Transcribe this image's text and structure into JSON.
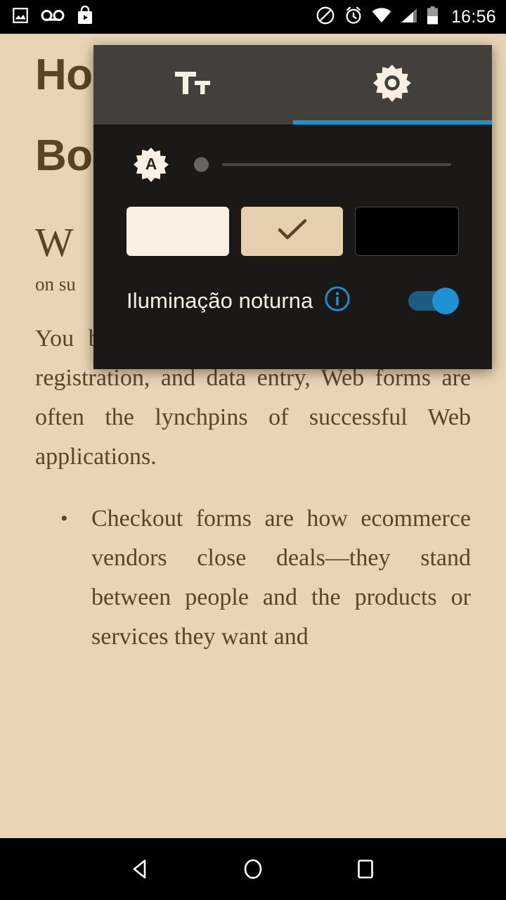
{
  "status_bar": {
    "left_icons": [
      {
        "name": "screenshot-image-icon",
        "glyph": "image"
      },
      {
        "name": "voicemail-icon",
        "glyph": "voicemail"
      },
      {
        "name": "play-store-icon",
        "glyph": "play-store"
      }
    ],
    "right_icons": [
      {
        "name": "do-not-disturb-icon",
        "glyph": "do-not-disturb"
      },
      {
        "name": "alarm-icon",
        "glyph": "alarm"
      },
      {
        "name": "wifi-icon",
        "glyph": "wifi"
      },
      {
        "name": "cell-signal-icon",
        "glyph": "signal"
      },
      {
        "name": "battery-icon",
        "glyph": "battery"
      }
    ],
    "clock": "16:56"
  },
  "book": {
    "heading_line1": "Ho",
    "heading_line2": "Bo",
    "chapter_initial": "W",
    "chapter_sub": "on su",
    "paragraph": "You bet we do. As arbiters of checkout, registration, and data entry, Web forms are often the lynchpins of successful Web applications.",
    "bullets": [
      "Checkout forms are how ecommerce vendors close deals—they stand between people and the products or services they want and"
    ]
  },
  "dialog": {
    "tabs": [
      {
        "name": "text-settings-tab",
        "icon": "text-size-icon",
        "label": "Tт",
        "selected": false
      },
      {
        "name": "brightness-settings-tab",
        "icon": "brightness-sun-icon",
        "label": "",
        "selected": true
      }
    ],
    "accent_color": "#1C92D2",
    "brightness": {
      "auto_icon_label": "A",
      "auto_icon_name": "auto-brightness-icon",
      "slider_value": 0,
      "slider_min": 0,
      "slider_max": 100
    },
    "themes": [
      {
        "name": "theme-swatch-white",
        "color": "#FBF0E4",
        "selected": false
      },
      {
        "name": "theme-swatch-sepia",
        "color": "#E5CFAC",
        "selected": true
      },
      {
        "name": "theme-swatch-black",
        "color": "#000000",
        "selected": false
      }
    ],
    "night_light": {
      "label": "Iluminação noturna",
      "info_icon": "info-icon",
      "enabled": true
    }
  },
  "nav_bar": {
    "buttons": [
      {
        "name": "nav-back-button",
        "glyph": "triangle-left"
      },
      {
        "name": "nav-home-button",
        "glyph": "circle"
      },
      {
        "name": "nav-recents-button",
        "glyph": "square"
      }
    ]
  }
}
